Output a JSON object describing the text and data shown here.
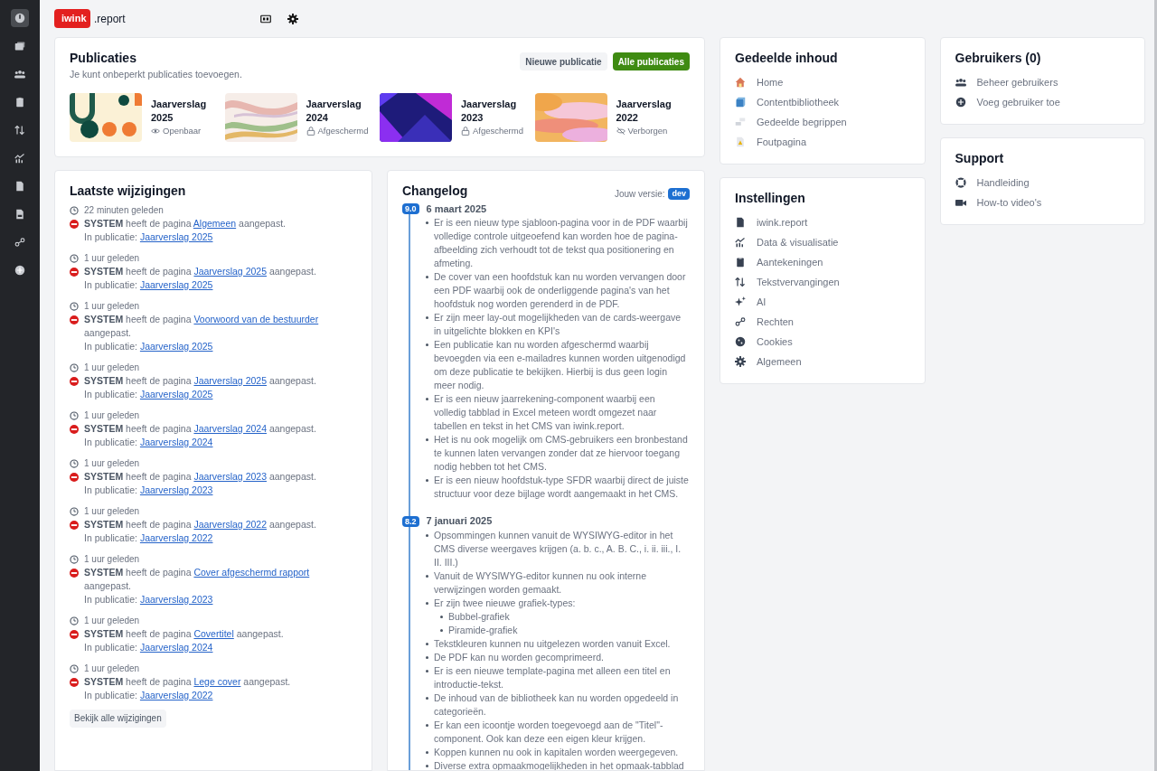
{
  "sidebar": {
    "items": [
      {
        "selected": true
      },
      {
        "selected": false
      },
      {
        "selected": false
      },
      {
        "selected": false
      },
      {
        "selected": false
      },
      {
        "selected": false
      },
      {
        "selected": false
      },
      {
        "selected": false
      },
      {
        "selected": false
      },
      {
        "selected": false
      }
    ]
  },
  "header": {
    "logo": "iwink",
    "logo_suffix": ".report"
  },
  "publications": {
    "title": "Publicaties",
    "subtitle": "Je kunt onbeperkt publicaties toevoegen.",
    "buttons": [
      {
        "label": "Nieuwe publicatie",
        "kind": "secondary"
      },
      {
        "label": "Alle publicaties",
        "kind": "primary"
      }
    ],
    "items": [
      {
        "title": "Jaarverslag 2025",
        "status": "Openbaar"
      },
      {
        "title": "Jaarverslag 2024",
        "status": "Afgeschermd"
      },
      {
        "title": "Jaarverslag 2023",
        "status": "Afgeschermd"
      },
      {
        "title": "Jaarverslag 2022",
        "status": "Verborgen"
      }
    ]
  },
  "recent_changes": {
    "title": "Laatste wijzigingen",
    "entries": [
      {
        "time": "22 minuten geleden",
        "user": "SYSTEM",
        "action": "heeft de pagina",
        "page": "Algemeen",
        "suffix": "aangepast.",
        "in_label": "In publicatie:",
        "publication": "Jaarverslag 2025"
      },
      {
        "time": "1 uur geleden",
        "user": "SYSTEM",
        "action": "heeft de pagina",
        "page": "Jaarverslag 2025",
        "suffix": "aangepast.",
        "in_label": "In publicatie:",
        "publication": "Jaarverslag 2025"
      },
      {
        "time": "1 uur geleden",
        "user": "SYSTEM",
        "action": "heeft de pagina",
        "page": "Voorwoord van de bestuurder",
        "suffix": "aangepast.",
        "in_label": "In publicatie:",
        "publication": "Jaarverslag 2025"
      },
      {
        "time": "1 uur geleden",
        "user": "SYSTEM",
        "action": "heeft de pagina",
        "page": "Jaarverslag 2025",
        "suffix": "aangepast.",
        "in_label": "In publicatie:",
        "publication": "Jaarverslag 2025"
      },
      {
        "time": "1 uur geleden",
        "user": "SYSTEM",
        "action": "heeft de pagina",
        "page": "Jaarverslag 2024",
        "suffix": "aangepast.",
        "in_label": "In publicatie:",
        "publication": "Jaarverslag 2024"
      },
      {
        "time": "1 uur geleden",
        "user": "SYSTEM",
        "action": "heeft de pagina",
        "page": "Jaarverslag 2023",
        "suffix": "aangepast.",
        "in_label": "In publicatie:",
        "publication": "Jaarverslag 2023"
      },
      {
        "time": "1 uur geleden",
        "user": "SYSTEM",
        "action": "heeft de pagina",
        "page": "Jaarverslag 2022",
        "suffix": "aangepast.",
        "in_label": "In publicatie:",
        "publication": "Jaarverslag 2022"
      },
      {
        "time": "1 uur geleden",
        "user": "SYSTEM",
        "action": "heeft de pagina",
        "page": "Cover afgeschermd rapport",
        "suffix": "aangepast.",
        "in_label": "In publicatie:",
        "publication": "Jaarverslag 2023"
      },
      {
        "time": "1 uur geleden",
        "user": "SYSTEM",
        "action": "heeft de pagina",
        "page": "Covertitel",
        "suffix": "aangepast.",
        "in_label": "In publicatie:",
        "publication": "Jaarverslag 2024"
      },
      {
        "time": "1 uur geleden",
        "user": "SYSTEM",
        "action": "heeft de pagina",
        "page": "Lege cover",
        "suffix": "aangepast.",
        "in_label": "In publicatie:",
        "publication": "Jaarverslag 2022"
      }
    ],
    "button": "Bekijk alle wijzigingen"
  },
  "changelog": {
    "title": "Changelog",
    "version_label": "Jouw versie:",
    "version": "dev",
    "releases": [
      {
        "version": "9.0",
        "date": "6 maart 2025",
        "items": [
          {
            "text": "Er is een nieuw type sjabloon-pagina voor in de PDF waarbij volledige controle uitgeoefend kan worden hoe de pagina-afbeelding zich verhoudt tot de tekst qua positionering en afmeting."
          },
          {
            "text": "De cover van een hoofdstuk kan nu worden vervangen door een PDF waarbij ook de onderliggende pagina's van het hoofdstuk nog worden gerenderd in de PDF."
          },
          {
            "text": "Er zijn meer lay-out mogelijkheden van de cards-weergave in uitgelichte blokken en KPI's"
          },
          {
            "text": "Een publicatie kan nu worden afgeschermd waarbij bevoegden via een e-mailadres kunnen worden uitgenodigd om deze publicatie te bekijken. Hierbij is dus geen login meer nodig."
          },
          {
            "text": "Er is een nieuw jaarrekening-component waarbij een volledig tabblad in Excel meteen wordt omgezet naar tabellen en tekst in het CMS van iwink.report."
          },
          {
            "text": "Het is nu ook mogelijk om CMS-gebruikers een bronbestand te kunnen laten vervangen zonder dat ze hiervoor toegang nodig hebben tot het CMS."
          },
          {
            "text": "Er is een nieuw hoofdstuk-type SFDR waarbij direct de juiste structuur voor deze bijlage wordt aangemaakt in het CMS."
          }
        ]
      },
      {
        "version": "8.2",
        "date": "7 januari 2025",
        "items": [
          {
            "text": "Opsommingen kunnen vanuit de WYSIWYG-editor in het CMS diverse weergaves krijgen (a. b. c., A. B. C., i. ii. iii., I. II. III.)"
          },
          {
            "text": "Vanuit de WYSIWYG-editor kunnen nu ook interne verwijzingen worden gemaakt."
          },
          {
            "text": "Er zijn twee nieuwe grafiek-types:",
            "children": [
              {
                "text": "Bubbel-grafiek"
              },
              {
                "text": "Piramide-grafiek"
              }
            ]
          },
          {
            "text": "Tekstkleuren kunnen nu uitgelezen worden vanuit Excel."
          },
          {
            "text": "De PDF kan nu worden gecomprimeerd."
          },
          {
            "text": "Er is een nieuwe template-pagina met alleen een titel en introductie-tekst."
          },
          {
            "text": "De inhoud van de bibliotheek kan nu worden opgedeeld in categorieën."
          },
          {
            "text": "Er kan een icoontje worden toegevoegd aan de \"Titel\"-component. Ook kan deze een eigen kleur krijgen."
          },
          {
            "text": "Koppen kunnen nu ook in kapitalen worden weergegeven."
          },
          {
            "text": "Diverse extra opmaakmogelijkheden in het opmaak-tabblad"
          }
        ]
      }
    ]
  },
  "shared_content": {
    "title": "Gedeelde inhoud",
    "items": [
      {
        "label": "Home"
      },
      {
        "label": "Contentbibliotheek"
      },
      {
        "label": "Gedeelde begrippen"
      },
      {
        "label": "Foutpagina"
      }
    ]
  },
  "settings": {
    "title": "Instellingen",
    "items": [
      {
        "label": "iwink.report"
      },
      {
        "label": "Data & visualisatie"
      },
      {
        "label": "Aantekeningen"
      },
      {
        "label": "Tekstvervangingen"
      },
      {
        "label": "AI"
      },
      {
        "label": "Rechten"
      },
      {
        "label": "Cookies"
      },
      {
        "label": "Algemeen"
      }
    ]
  },
  "users": {
    "title": "Gebruikers (0)",
    "items": [
      {
        "label": "Beheer gebruikers"
      },
      {
        "label": "Voeg gebruiker toe"
      }
    ]
  },
  "support": {
    "title": "Support",
    "items": [
      {
        "label": "Handleiding"
      },
      {
        "label": "How-to video's"
      }
    ]
  }
}
